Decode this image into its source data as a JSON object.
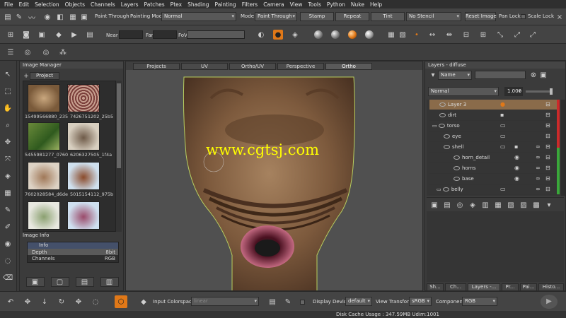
{
  "menubar": [
    "File",
    "Edit",
    "Selection",
    "Objects",
    "Channels",
    "Layers",
    "Patches",
    "Ptex",
    "Shading",
    "Painting",
    "Filters",
    "Camera",
    "View",
    "Tools",
    "Python",
    "Nuke",
    "Help"
  ],
  "toolbar1": {
    "paint_through": "Paint Through",
    "painting_mode_label": "Painting Mode",
    "painting_mode_value": "Normal",
    "mode_label": "Mode",
    "mode_value": "Paint Through",
    "stamp": "Stamp",
    "repeat": "Repeat",
    "tint": "Tint",
    "stencil_value": "No Stencil",
    "reset_image": "Reset Image",
    "pan_lock": "Pan Lock",
    "scale_lock": "Scale Lock"
  },
  "toolbar2": {
    "near_label": "Near",
    "far_label": "Far",
    "fov_label": "FoV"
  },
  "image_manager": {
    "title": "Image Manager",
    "tab": "Project",
    "thumb_labels": [
      "15499566880_235",
      "7426751202_25b5",
      "5455981277_0760",
      "6206327505_1f4a",
      "7602028584_d6de",
      "5015154112_975b"
    ],
    "image_info_title": "Image Info",
    "info_header": "Info",
    "info_rows": [
      {
        "key": "Depth",
        "value": "8bit"
      },
      {
        "key": "Channels",
        "value": "RGB"
      }
    ]
  },
  "viewport": {
    "tabs": [
      "Projects",
      "UV",
      "Ortho/UV",
      "Perspective",
      "Ortho"
    ],
    "active_tab": "Ortho",
    "watermark": "www.cgtsj.com"
  },
  "layers_panel": {
    "title": "Layers - diffuse",
    "filter_value": "Name",
    "blend_mode": "Normal",
    "opacity": "1.000",
    "layers": [
      {
        "name": "Layer 3",
        "indent": 0,
        "selected": true
      },
      {
        "name": "dirt",
        "indent": 0,
        "selected": false
      },
      {
        "name": "torso",
        "indent": 0,
        "selected": false
      },
      {
        "name": "eye",
        "indent": 1,
        "selected": false
      },
      {
        "name": "shell",
        "indent": 1,
        "selected": false
      },
      {
        "name": "horn_detail",
        "indent": 2,
        "selected": false
      },
      {
        "name": "horns",
        "indent": 2,
        "selected": false
      },
      {
        "name": "base",
        "indent": 2,
        "selected": false
      },
      {
        "name": "belly",
        "indent": 1,
        "selected": false
      }
    ],
    "bottom_tabs": [
      "Sh...",
      "Ch...",
      "Layers -...",
      "Pr...",
      "Pai...",
      "Histo..."
    ]
  },
  "bottombar": {
    "input_colorspace_label": "Input Colorspace",
    "input_colorspace_value": "linear",
    "display_device_label": "Display Device",
    "display_device_value": "default",
    "view_transform_label": "View Transform",
    "view_transform_value": "sRGB",
    "component_label": "Component",
    "component_value": "RGB"
  },
  "status": {
    "text": "Disk Cache Usage : 347.59MB  Udim:1001"
  },
  "colors": {
    "accent_orange": "#e07818",
    "layer_selected": "#8a6b4a",
    "lock_red": "#cc2a2a",
    "lock_green": "#3aa83a"
  }
}
